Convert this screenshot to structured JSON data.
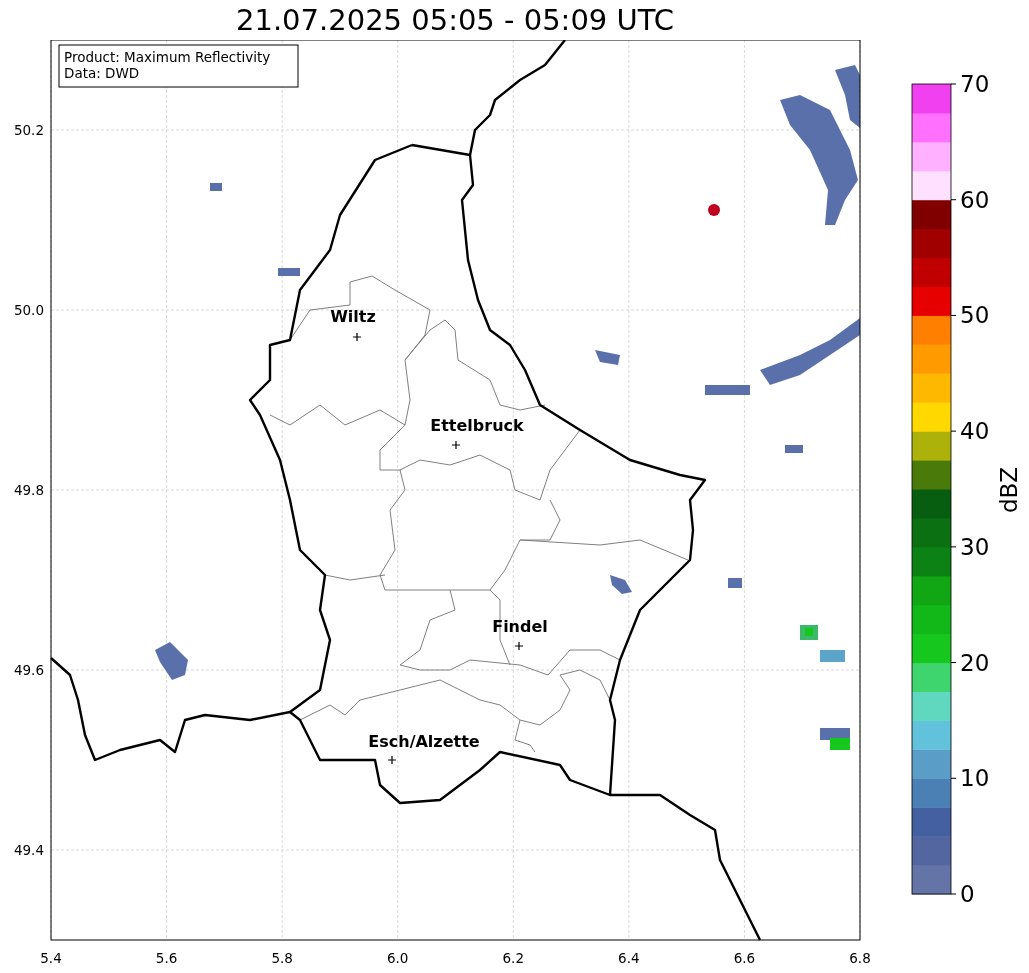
{
  "title": "21.07.2025 05:05 - 05:09 UTC",
  "info": [
    "Product: Maximum Reflectivity",
    "Data: DWD"
  ],
  "x_ticks": [
    "5.4",
    "5.6",
    "5.8",
    "6.0",
    "6.2",
    "6.4",
    "6.6",
    "6.8"
  ],
  "y_ticks": [
    "50.2",
    "50.0",
    "49.8",
    "49.6",
    "49.4"
  ],
  "cities": [
    {
      "name": "Wiltz"
    },
    {
      "name": "Ettelbruck"
    },
    {
      "name": "Findel"
    },
    {
      "name": "Esch/Alzette"
    }
  ],
  "colorbar": {
    "label": "dBZ",
    "ticks": [
      "70",
      "60",
      "50",
      "40",
      "30",
      "20",
      "10",
      "0"
    ],
    "bands": [
      {
        "color": "#6474a6"
      },
      {
        "color": "#5466a0"
      },
      {
        "color": "#4560a0"
      },
      {
        "color": "#4a80b4"
      },
      {
        "color": "#5a9ec8"
      },
      {
        "color": "#62c2dc"
      },
      {
        "color": "#60d8c0"
      },
      {
        "color": "#3ed46e"
      },
      {
        "color": "#16c81e"
      },
      {
        "color": "#12b818"
      },
      {
        "color": "#10a614"
      },
      {
        "color": "#0c8214"
      },
      {
        "color": "#0a7012"
      },
      {
        "color": "#085e10"
      },
      {
        "color": "#4a7a0a"
      },
      {
        "color": "#acb20a"
      },
      {
        "color": "#ffd800"
      },
      {
        "color": "#ffb800"
      },
      {
        "color": "#ff9a00"
      },
      {
        "color": "#ff7f00"
      },
      {
        "color": "#e60000"
      },
      {
        "color": "#c00000"
      },
      {
        "color": "#a00000"
      },
      {
        "color": "#800000"
      },
      {
        "color": "#ffe0ff"
      },
      {
        "color": "#ffb0ff"
      },
      {
        "color": "#ff70ff"
      },
      {
        "color": "#f040f0"
      }
    ]
  }
}
